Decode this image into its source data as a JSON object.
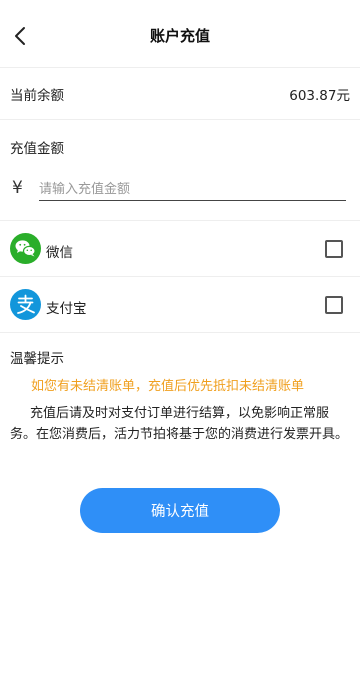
{
  "header": {
    "title": "账户充值"
  },
  "balance": {
    "label": "当前余额",
    "value": "603.87元"
  },
  "amount": {
    "label": "充值金额",
    "currency_symbol": "¥",
    "placeholder": "请输入充值金额",
    "value": ""
  },
  "payment_methods": [
    {
      "name": "微信",
      "icon": "wechat-icon",
      "color": "#2aae2a",
      "checked": false
    },
    {
      "name": "支付宝",
      "icon": "alipay-icon",
      "color": "#1296db",
      "checked": false
    }
  ],
  "tips": {
    "title": "温馨提示",
    "warning": "如您有未结清账单，充值后优先抵扣未结清账单",
    "warning_color": "#f0a020",
    "body": "充值后请及时对支付订单进行结算，以免影响正常服务。在您消费后，活力节拍将基于您的消费进行发票开具。"
  },
  "confirm_button": {
    "label": "确认充值",
    "color": "#2f8ff7"
  }
}
